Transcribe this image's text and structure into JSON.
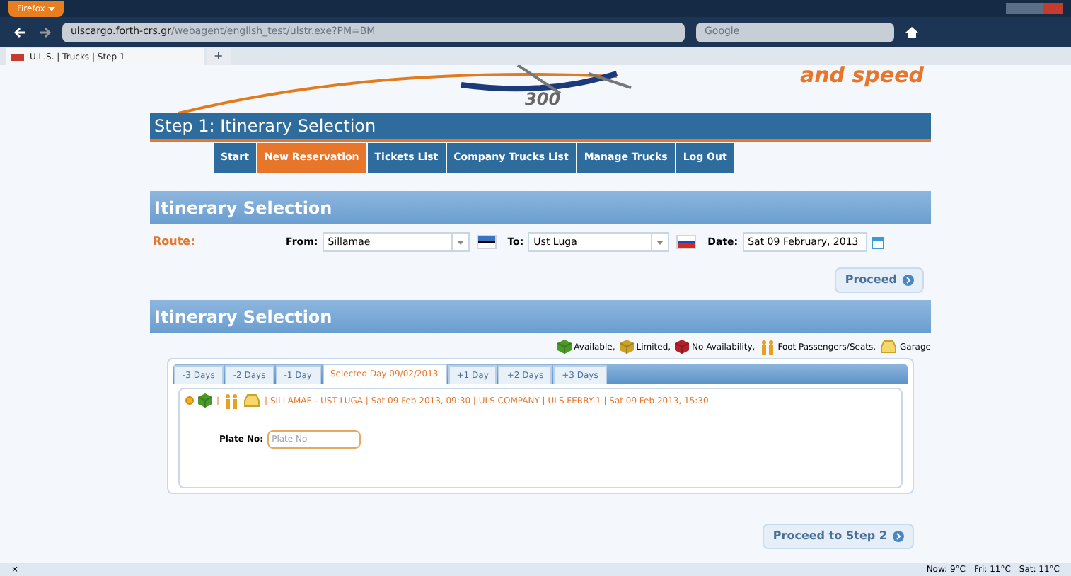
{
  "browser": {
    "menu_button": "Firefox",
    "url_host": "ulscargo.forth-crs.gr",
    "url_path": "/webagent/english_test/ulstr.exe?PM=BM",
    "search_placeholder": "Google",
    "tab_title": "U.L.S. | Trucks | Step 1",
    "new_tab": "+"
  },
  "banner": {
    "gauge_text": "300",
    "slogan": "and speed"
  },
  "step_title": "Step 1: Itinerary Selection",
  "nav": [
    {
      "label": "Start",
      "selected": false
    },
    {
      "label": "New Reservation",
      "selected": true
    },
    {
      "label": "Tickets List",
      "selected": false
    },
    {
      "label": "Company Trucks List",
      "selected": false
    },
    {
      "label": "Manage Trucks",
      "selected": false
    },
    {
      "label": "Log Out",
      "selected": false
    }
  ],
  "route_section": {
    "title": "Itinerary Selection",
    "route_label": "Route:",
    "from_label": "From:",
    "from_value": "Sillamae",
    "to_label": "To:",
    "to_value": "Ust Luga",
    "date_label": "Date:",
    "date_value": "Sat 09 February, 2013",
    "proceed": "Proceed"
  },
  "results_section": {
    "title": "Itinerary Selection",
    "legend": [
      {
        "kind": "available",
        "label": "Available,"
      },
      {
        "kind": "limited",
        "label": "Limited,"
      },
      {
        "kind": "none",
        "label": "No Availability,"
      },
      {
        "kind": "foot",
        "label": "Foot Passengers/Seats,"
      },
      {
        "kind": "garage",
        "label": "Garage"
      }
    ],
    "day_tabs": [
      {
        "label": "-3 Days",
        "selected": false
      },
      {
        "label": "-2 Days",
        "selected": false
      },
      {
        "label": "-1 Day",
        "selected": false
      },
      {
        "label": "Selected Day 09/02/2013",
        "selected": true
      },
      {
        "label": "+1 Day",
        "selected": false
      },
      {
        "label": "+2 Days",
        "selected": false
      },
      {
        "label": "+3 Days",
        "selected": false
      }
    ],
    "trip": {
      "summary": "| SILLAMAE - UST LUGA | Sat 09 Feb 2013, 09:30 | ULS COMPANY | ULS FERRY-1 | Sat 09 Feb 2013, 15:30",
      "separator": "|",
      "plate_label": "Plate No:",
      "plate_placeholder": "Plate No"
    },
    "proceed": "Proceed to Step 2"
  },
  "status_bar": {
    "close": "×",
    "weather": [
      {
        "label": "Now: 9°C"
      },
      {
        "label": "Fri: 11°C"
      },
      {
        "label": "Sat: 11°C"
      }
    ]
  }
}
